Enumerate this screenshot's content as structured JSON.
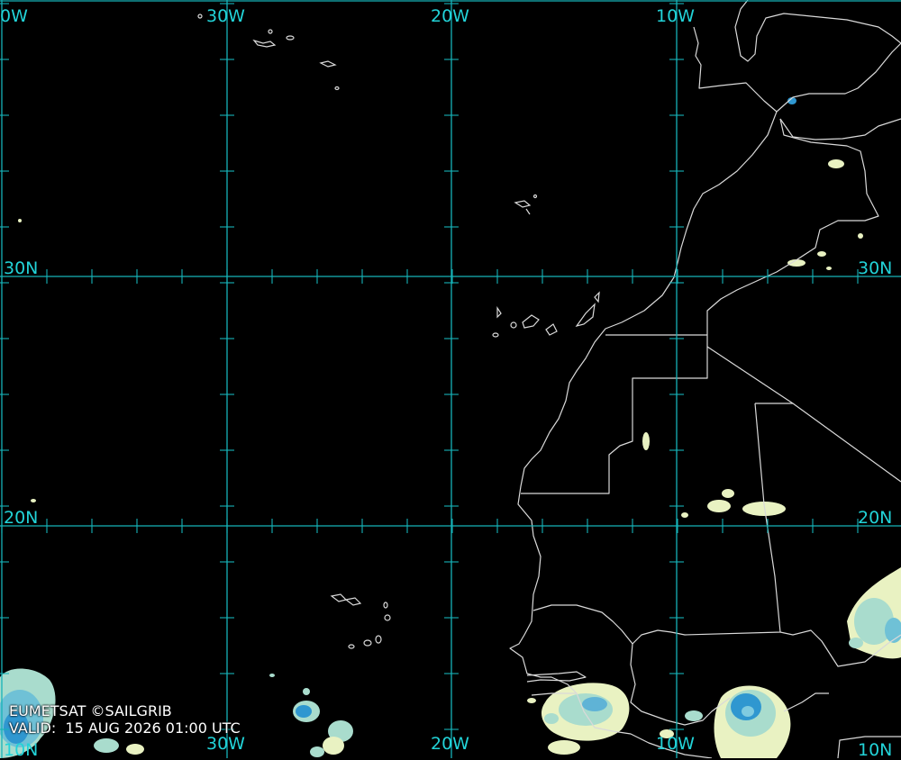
{
  "colors": {
    "grid": "#16b3b8",
    "label": "#22d3d8",
    "coast": "#d9d9d9",
    "cloud_light": "#e9f2c2",
    "cloud_mid": "#a9dccd",
    "cloud_deep": "#2f97d0"
  },
  "labels": {
    "lon_top": [
      "0W",
      "30W",
      "20W",
      "10W"
    ],
    "lon_bottom": [
      "30W",
      "20W",
      "10W"
    ],
    "lat_left": [
      "30N",
      "20N",
      "10N"
    ],
    "lat_right": [
      "30N",
      "20N",
      "10N"
    ]
  },
  "credit": {
    "source": "EUMETSAT ©SAILGRIB",
    "valid": "VALID:  15 AUG 2026 01:00 UTC"
  }
}
